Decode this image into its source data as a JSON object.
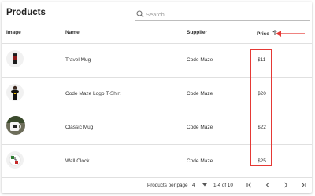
{
  "header": {
    "title": "Products",
    "search_placeholder": "Search"
  },
  "columns": {
    "image": "Image",
    "name": "Name",
    "supplier": "Supplier",
    "price": "Price"
  },
  "rows": [
    {
      "name": "Travel Mug",
      "supplier": "Code Maze",
      "price": "$11"
    },
    {
      "name": "Code Maze Logo T-Shirt",
      "supplier": "Code Maze",
      "price": "$20"
    },
    {
      "name": "Classic Mug",
      "supplier": "Code Maze",
      "price": "$22"
    },
    {
      "name": "Wall Clock",
      "supplier": "Code Maze",
      "price": "$25"
    }
  ],
  "pagination": {
    "per_page_label": "Products per page",
    "per_page_value": "4",
    "range": "1-4 of 10"
  },
  "colors": {
    "annotation": "#e53935"
  }
}
